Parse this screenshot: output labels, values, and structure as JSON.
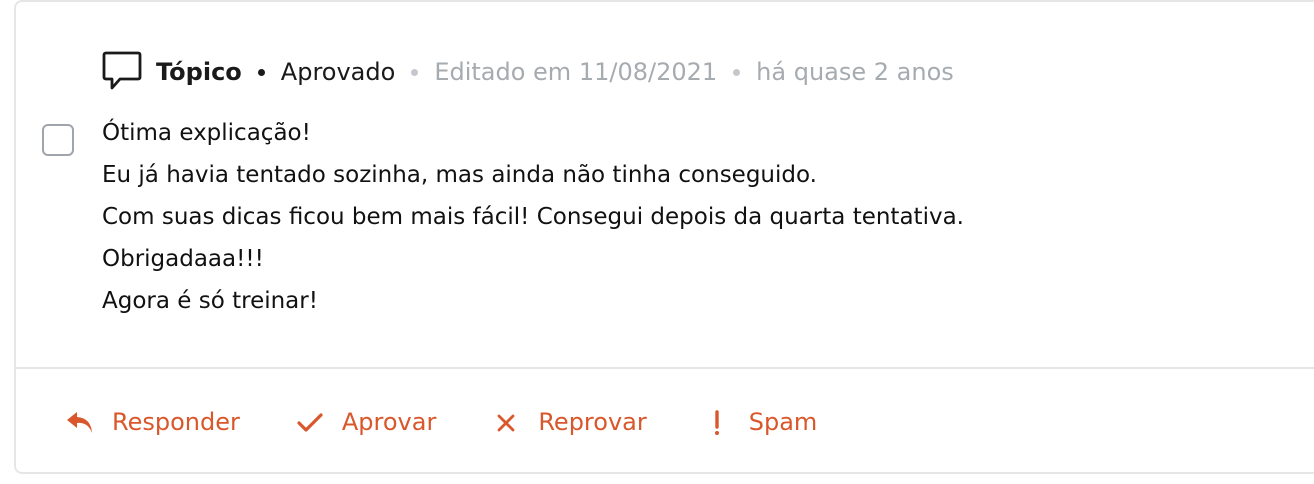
{
  "comment": {
    "type_label": "Tópico",
    "status": "Aprovado",
    "edited": "Editado em 11/08/2021",
    "relative_time": "há quase 2 anos",
    "message_lines": [
      "Ótima explicação!",
      "Eu já havia tentado sozinha, mas ainda não tinha conseguido.",
      "Com suas dicas ficou bem mais fácil! Consegui depois da quarta tentativa.",
      "Obrigadaaa!!!",
      "Agora é só treinar!"
    ],
    "selected": false
  },
  "actions": {
    "reply": {
      "label": "Responder",
      "icon": "reply-icon"
    },
    "approve": {
      "label": "Aprovar",
      "icon": "check-icon"
    },
    "reject": {
      "label": "Reprovar",
      "icon": "close-icon"
    },
    "spam": {
      "label": "Spam",
      "icon": "exclamation-icon"
    }
  },
  "colors": {
    "accent": "#d9572b",
    "muted": "#a6abb0",
    "text": "#1a1a1a",
    "border": "#e6e6e6"
  }
}
